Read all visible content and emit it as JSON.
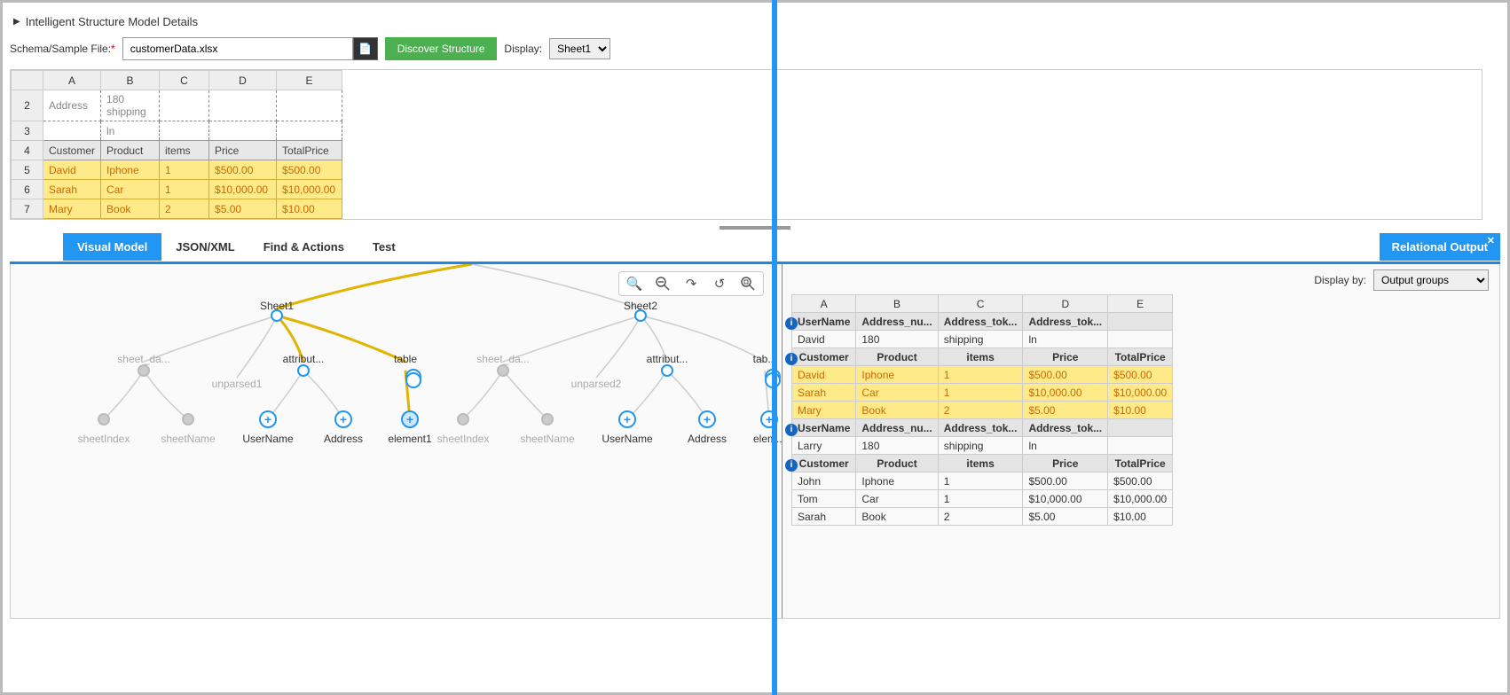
{
  "header": {
    "title": "Intelligent Structure Model Details"
  },
  "form": {
    "file_label": "Schema/Sample File:",
    "file_value": "customerData.xlsx",
    "discover_label": "Discover Structure",
    "display_label": "Display:",
    "display_value": "Sheet1"
  },
  "top_grid": {
    "cols": [
      "A",
      "B",
      "C",
      "D",
      "E"
    ],
    "rows": [
      {
        "n": "2",
        "cells": [
          "Address",
          "180 shipping",
          "",
          "",
          ""
        ],
        "style": "dashed"
      },
      {
        "n": "3",
        "cells": [
          "",
          "ln",
          "",
          "",
          ""
        ],
        "style": "dashed"
      },
      {
        "n": "4",
        "cells": [
          "Customer",
          "Product",
          "items",
          "Price",
          "TotalPrice"
        ],
        "style": "header"
      },
      {
        "n": "5",
        "cells": [
          "David",
          "Iphone",
          "1",
          "$500.00",
          "$500.00"
        ],
        "style": "data"
      },
      {
        "n": "6",
        "cells": [
          "Sarah",
          "Car",
          "1",
          "$10,000.00",
          "$10,000.00"
        ],
        "style": "data"
      },
      {
        "n": "7",
        "cells": [
          "Mary",
          "Book",
          "2",
          "$5.00",
          "$10.00"
        ],
        "style": "data"
      }
    ]
  },
  "tabs": {
    "items": [
      "Visual Model",
      "JSON/XML",
      "Find & Actions",
      "Test"
    ],
    "relational": "Relational Output"
  },
  "tree": {
    "sheet1": "Sheet1",
    "sheet2": "Sheet2",
    "sheet_da": "sheet_da...",
    "unparsed1": "unparsed1",
    "attribut": "attribut...",
    "table": "table",
    "tab": "tab...",
    "unparsed2": "unparsed2",
    "sheetIndex": "sheetIndex",
    "sheetName": "sheetName",
    "UserName": "UserName",
    "Address": "Address",
    "element1": "element1",
    "elem": "elem..."
  },
  "right": {
    "displayby_label": "Display by:",
    "displayby_value": "Output groups",
    "cols": [
      "A",
      "B",
      "C",
      "D",
      "E"
    ],
    "h1": [
      "UserName",
      "Address_nu...",
      "Address_tok...",
      "Address_tok...",
      ""
    ],
    "d1": [
      "David",
      "180",
      "shipping",
      "ln",
      ""
    ],
    "h2": [
      "Customer",
      "Product",
      "items",
      "Price",
      "TotalPrice"
    ],
    "d2": [
      [
        "David",
        "Iphone",
        "1",
        "$500.00",
        "$500.00"
      ],
      [
        "Sarah",
        "Car",
        "1",
        "$10,000.00",
        "$10,000.00"
      ],
      [
        "Mary",
        "Book",
        "2",
        "$5.00",
        "$10.00"
      ]
    ],
    "h3": [
      "UserName",
      "Address_nu...",
      "Address_tok...",
      "Address_tok...",
      ""
    ],
    "d3": [
      "Larry",
      "180",
      "shipping",
      "ln",
      ""
    ],
    "h4": [
      "Customer",
      "Product",
      "items",
      "Price",
      "TotalPrice"
    ],
    "d4": [
      [
        "John",
        "Iphone",
        "1",
        "$500.00",
        "$500.00"
      ],
      [
        "Tom",
        "Car",
        "1",
        "$10,000.00",
        "$10,000.00"
      ],
      [
        "Sarah",
        "Book",
        "2",
        "$5.00",
        "$10.00"
      ]
    ]
  }
}
